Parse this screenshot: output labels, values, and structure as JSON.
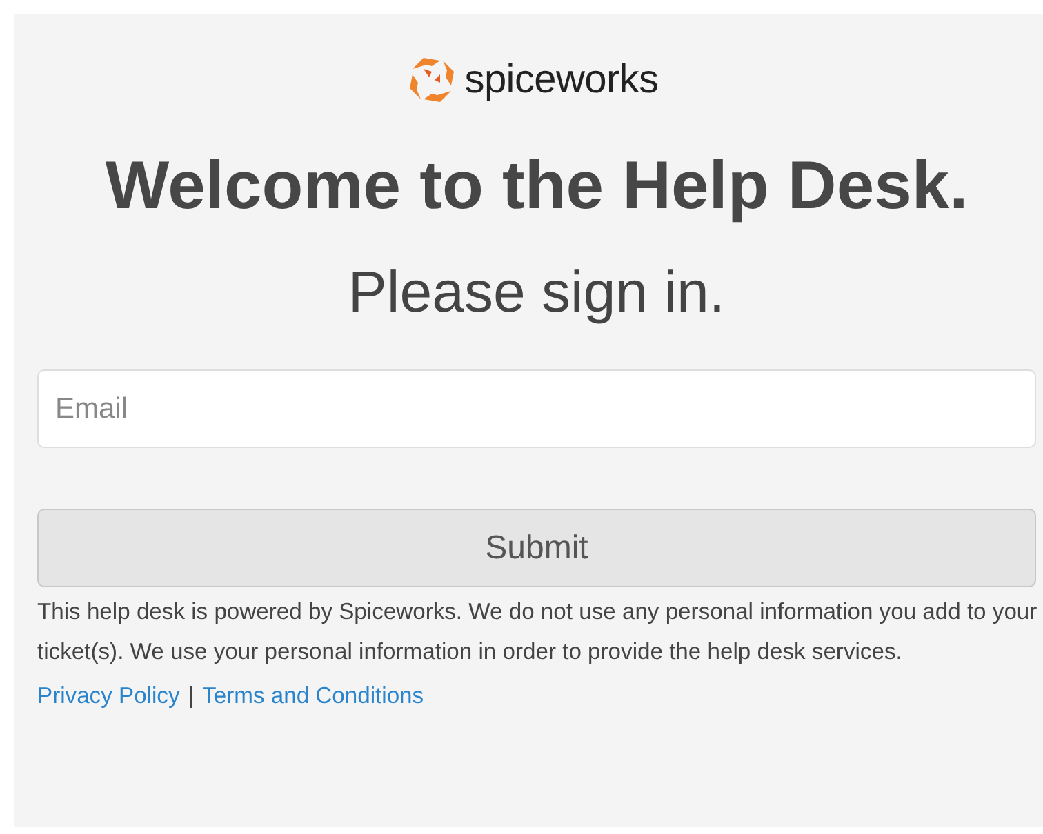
{
  "logo": {
    "text": "spiceworks"
  },
  "heading": "Welcome to the Help Desk.",
  "subheading": "Please sign in.",
  "email_field": {
    "placeholder": "Email"
  },
  "submit_button": "Submit",
  "notice": "This help desk is powered by Spiceworks. We do not use any personal information you add to your ticket(s). We use your personal information in order to provide the help desk services.",
  "links": [
    {
      "label": "Privacy Policy"
    },
    {
      "label": "Terms and Conditions"
    }
  ],
  "link_separator": "|"
}
